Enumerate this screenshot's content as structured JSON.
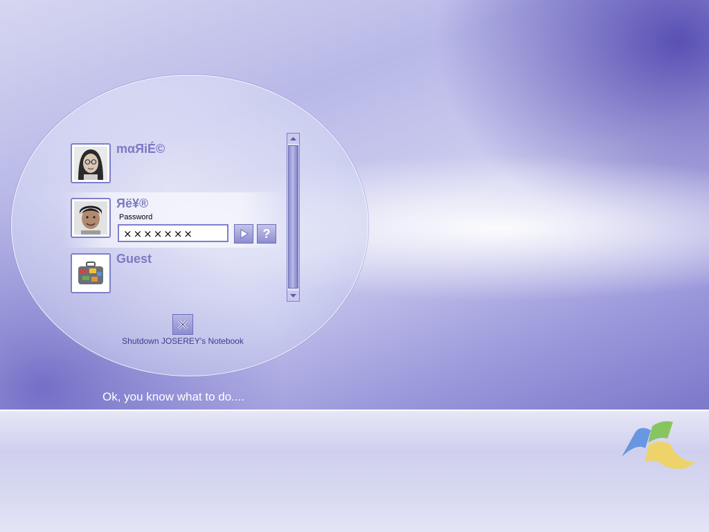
{
  "users": [
    {
      "name": "mαЯiÉ©",
      "avatar_icon": "woman-glasses-avatar-icon",
      "selected": false
    },
    {
      "name": "Яë¥®",
      "avatar_icon": "man-avatar-icon",
      "selected": true
    },
    {
      "name": "Guest",
      "avatar_icon": "suitcase-avatar-icon",
      "selected": false
    }
  ],
  "password": {
    "label": "Password",
    "value": "×××××××"
  },
  "go_button_icon": "arrow-right-icon",
  "help_button_label": "?",
  "shutdown": {
    "label": "Shutdown JOSEREY's Notebook",
    "icon": "close-x-icon"
  },
  "hint_text": "Ok, you know what to do....",
  "colors": {
    "accent": "#7d7ec9",
    "username": "#7a79c3",
    "dark_band": "#4a46b0"
  }
}
